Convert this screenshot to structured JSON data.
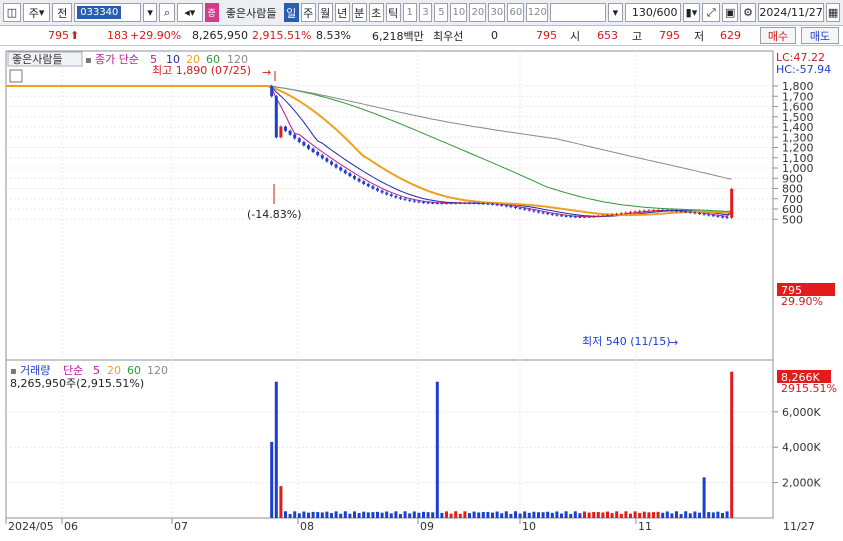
{
  "toolbar": {
    "mode": "주",
    "mode2": "전",
    "code": "033340",
    "name": "좋은사람들",
    "name_badge": "증",
    "periods": [
      "일",
      "주",
      "월",
      "년",
      "분",
      "초",
      "틱"
    ],
    "ticks": [
      "1",
      "3",
      "5",
      "10",
      "20",
      "30",
      "60",
      "120"
    ],
    "count": "130/600",
    "date": "2024/11/27"
  },
  "quote": {
    "price": "795",
    "change": "183",
    "rate": "+29.90%",
    "volume": "8,265,950",
    "vol_rate": "2,915.51%",
    "turnover": "8.53%",
    "amount": "6,218백만",
    "pref_label": "최우선",
    "pref_val": "0",
    "bid": "795",
    "open_label": "시",
    "open": "653",
    "high_label": "고",
    "high": "795",
    "low_label": "저",
    "low": "629",
    "buy": "매수",
    "sell": "매도"
  },
  "price_panel": {
    "title": "좋은사람들",
    "legend_label": "종가 단순",
    "ma": [
      "5",
      "10",
      "20",
      "60",
      "120"
    ],
    "lc": "LC:47.22",
    "hc": "HC:-57.94",
    "max_label": "최고 1,890 (07/25)",
    "min_label": "최저 540 (11/15)",
    "drop_label": "(-14.83%)",
    "last_price": "795",
    "last_rate": "29.90%",
    "yticks": [
      "1,800",
      "1,700",
      "1,600",
      "1,500",
      "1,400",
      "1,300",
      "1,200",
      "1,100",
      "1,000",
      "900",
      "800",
      "700",
      "600",
      "500"
    ]
  },
  "vol_panel": {
    "title": "거래량",
    "legend_label": "단순",
    "ma": [
      "5",
      "20",
      "60",
      "120"
    ],
    "summary": "8,265,950주(2,915.51%)",
    "last_vol": "8,266K",
    "last_rate": "2915.51%",
    "yticks": [
      "6,000K",
      "4,000K",
      "2,000K"
    ]
  },
  "xaxis": {
    "labels": [
      "2024/05",
      "06",
      "07",
      "08",
      "09",
      "10",
      "11"
    ],
    "end": "11/27"
  },
  "colors": {
    "up": "#e31b1b",
    "down": "#1a3fd2",
    "ma5": "#c0189a",
    "ma10": "#1d2aa6",
    "ma20": "#f0a020",
    "ma60": "#2f9a2f",
    "ma120": "#8a8a8a"
  }
}
